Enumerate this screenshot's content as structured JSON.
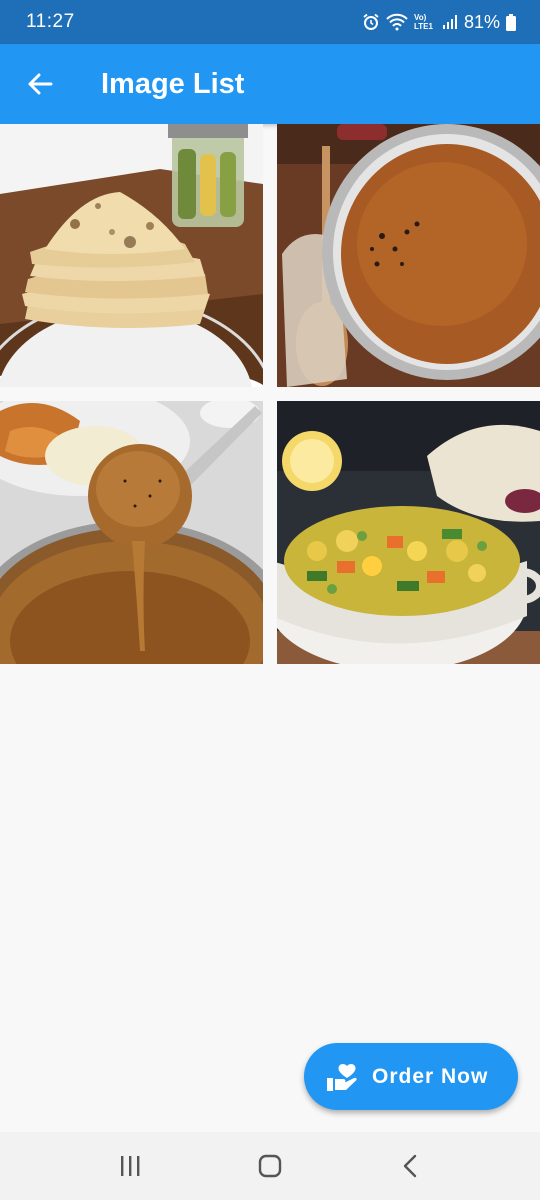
{
  "status_bar": {
    "time": "11:27",
    "network_label": "Vo) LTE1",
    "battery_percent": "81%",
    "icons": [
      "alarm-icon",
      "wifi-icon",
      "volte-icon",
      "signal-icon",
      "battery-icon"
    ]
  },
  "app_bar": {
    "title": "Image List",
    "back_icon": "arrow-back-icon"
  },
  "images": [
    {
      "name": "flatbread-stack-image"
    },
    {
      "name": "dal-pan-image"
    },
    {
      "name": "gravy-ladle-image"
    },
    {
      "name": "vegetable-curry-image"
    }
  ],
  "fab": {
    "label": "Order Now",
    "icon": "hand-heart-icon"
  },
  "nav_bar": {
    "icons": [
      "recent-apps-icon",
      "home-icon",
      "back-icon"
    ]
  },
  "colors": {
    "status_bar": "#1e6fb8",
    "primary": "#2196f3",
    "background": "#f8f8f8"
  }
}
